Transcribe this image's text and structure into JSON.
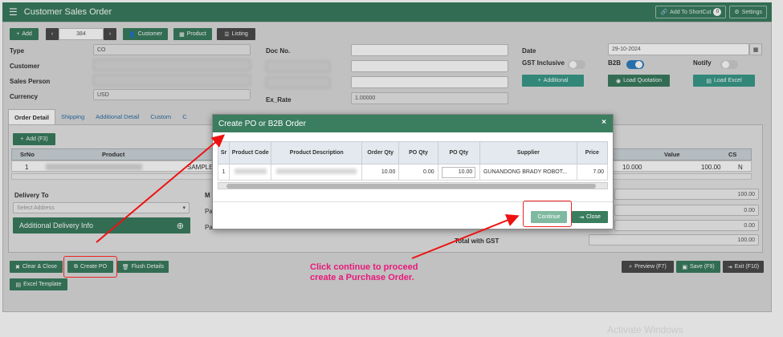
{
  "app": {
    "title": "Customer Sales Order",
    "add_shortcut": "Add To ShortCut",
    "shortcut_count": "0",
    "settings": "Settings"
  },
  "toolbar": {
    "add": "Add",
    "record_no": "384",
    "customer": "Customer",
    "product": "Product",
    "listing": "Listing"
  },
  "header_form": {
    "type_label": "Type",
    "type_value": "CO",
    "customer_label": "Customer",
    "sales_person_label": "Sales Person",
    "currency_label": "Currency",
    "currency_value": "USD",
    "doc_no_label": "Doc No.",
    "ex_rate_label": "Ex_Rate",
    "ex_rate_value": "1.00000",
    "date_label": "Date",
    "date_value": "29-10-2024",
    "gst_label": "GST Inclusive",
    "b2b_label": "B2B",
    "notify_label": "Notify",
    "gst_on": false,
    "b2b_on": true,
    "notify_on": false,
    "additional_btn": "Additional",
    "load_quotation_btn": "Load Quotation",
    "load_excel_btn": "Load Excel"
  },
  "tabs": [
    "Order Detail",
    "Shipping",
    "Additional Detail",
    "Custom",
    "C"
  ],
  "grid": {
    "add_btn": "Add (F3)",
    "columns": [
      "SrNo",
      "Product",
      "Value",
      "CS"
    ],
    "row": {
      "srno": "1",
      "sample": "SAMPLE",
      "qty": "10.000",
      "value": "100.00",
      "cs": "N"
    }
  },
  "delivery": {
    "label": "Delivery To",
    "select_placeholder": "Select Address",
    "info_btn": "Additional Delivery Info",
    "ma_label": "M",
    "pa_label1": "Pa",
    "pa_label2": "Pa"
  },
  "totals": {
    "v1": "100.00",
    "v2": "0.00",
    "v3": "0.00",
    "total_gst_label": "Total with GST",
    "total_gst_value": "100.00"
  },
  "bottom": {
    "clear_close": "Clear & Close",
    "create_po": "Create PO",
    "flush": "Flush Details",
    "excel_template": "Excel Template",
    "preview": "Preview (F7)",
    "save": "Save (F9)",
    "exit": "Exit (F10)"
  },
  "modal": {
    "title": "Create PO or B2B Order",
    "close_x": "×",
    "headers": [
      "Sr",
      "Product Code",
      "Product Description",
      "Order Qty",
      "PO Qty",
      "PO Qty",
      "Supplier",
      "Price"
    ],
    "row": {
      "sr": "1",
      "order_qty": "10.00",
      "po_qty": "0.00",
      "po_qty_input": "10.00",
      "supplier": "GUNANDONG BRADY ROBOT...",
      "price": "7.00"
    },
    "continue": "Continue",
    "close": "Close"
  },
  "annotation": {
    "line1": "Click continue to proceed",
    "line2": "create a Purchase Order."
  },
  "watermark": "Activate Windows",
  "colors": {
    "primary": "#3a7d5f",
    "annotation": "#e8197a",
    "arrow": "#ee1111"
  }
}
